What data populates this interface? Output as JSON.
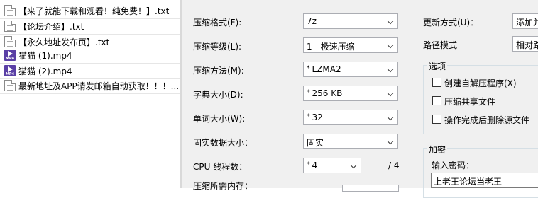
{
  "files": [
    {
      "icon": "text-file-icon",
      "name": "【来了就能下载和观看！纯免费！】.txt"
    },
    {
      "icon": "text-file-icon",
      "name": "【论坛介绍】.txt"
    },
    {
      "icon": "text-file-icon",
      "name": "【永久地址发布页】.txt"
    },
    {
      "icon": "video-file-icon",
      "name": "猫猫 (1).mp4",
      "badge": "MP4"
    },
    {
      "icon": "video-file-icon",
      "name": "猫猫 (2).mp4",
      "badge": "MP4"
    },
    {
      "icon": "text-file-icon",
      "name": "最新地址及APP请发邮箱自动获取！！！...."
    }
  ],
  "settings": {
    "format": {
      "label": "压缩格式(F):",
      "value": "7z"
    },
    "level": {
      "label": "压缩等级(L):",
      "value": "1 - 极速压缩"
    },
    "method": {
      "label": "压缩方法(M):",
      "value": "LZMA2",
      "star": "*"
    },
    "dict": {
      "label": "字典大小(D):",
      "value": "256 KB",
      "star": "*"
    },
    "word": {
      "label": "单词大小(W):",
      "value": "32",
      "star": "*"
    },
    "solid": {
      "label": "固实数据大小：",
      "value": "固实"
    },
    "threads": {
      "label": "CPU 线程数：",
      "value": "4",
      "star": "*",
      "total": "/ 4"
    },
    "memory": {
      "label": "压缩所需内存："
    }
  },
  "update": {
    "label": "更新方式(U)：",
    "value": "添加并"
  },
  "pathmode": {
    "label": "路径模式",
    "value": "相对路"
  },
  "options": {
    "title": "选项",
    "items": [
      {
        "label": "创建自解压程序(X)",
        "checked": false
      },
      {
        "label": "压缩共享文件",
        "checked": false
      },
      {
        "label": "操作完成后删除源文件",
        "checked": false
      }
    ]
  },
  "encryption": {
    "title": "加密",
    "password_label": "输入密码：",
    "password_value": "上老王论坛当老王"
  }
}
